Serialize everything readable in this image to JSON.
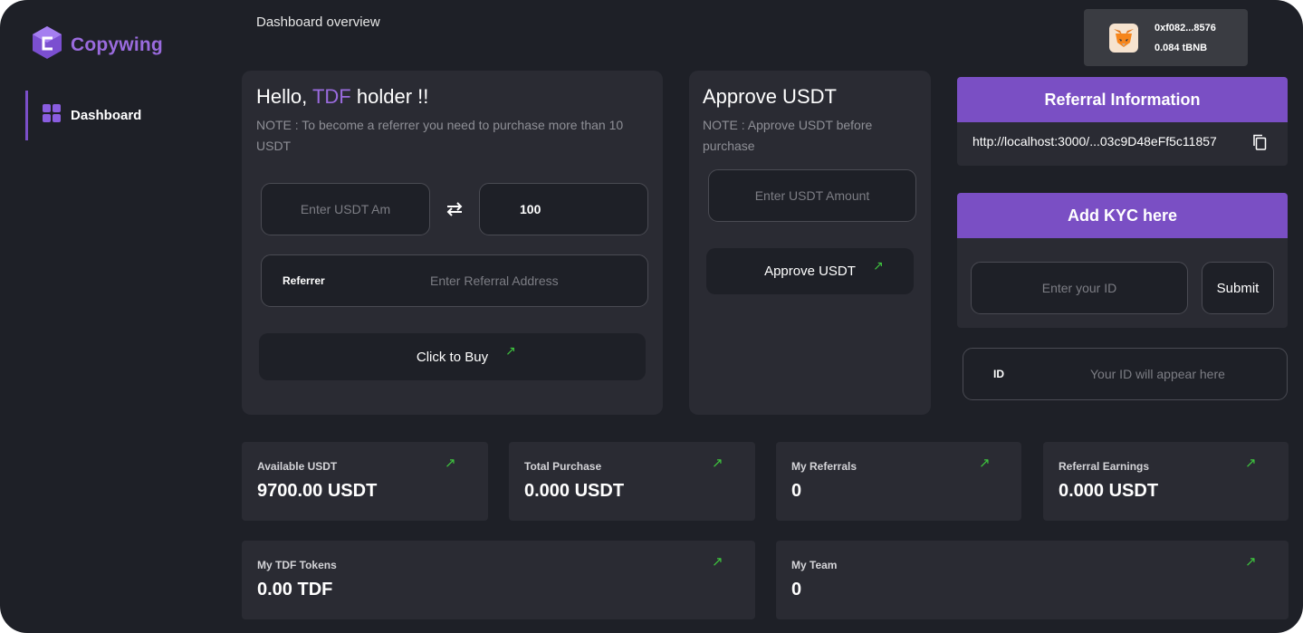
{
  "brand": {
    "name": "Copywing",
    "accent": "#9a6bde"
  },
  "sidebar": {
    "items": [
      {
        "label": "Dashboard",
        "icon": "grid-icon"
      }
    ]
  },
  "header": {
    "title": "Dashboard overview"
  },
  "wallet": {
    "address": "0xf082...8576",
    "balance": "0.084 tBNB",
    "icon": "metamask-fox-icon"
  },
  "buy_card": {
    "greeting_prefix": "Hello,",
    "greeting_token": "TDF",
    "greeting_suffix": "holder !!",
    "note": "NOTE : To become a referrer you need to purchase more than 10 USDT",
    "usdt_placeholder": "Enter USDT Am",
    "token_value": "100",
    "referrer_label": "Referrer",
    "referrer_placeholder": "Enter Referral Address",
    "buy_label": "Click to Buy"
  },
  "approve_card": {
    "title": "Approve USDT",
    "note": "NOTE : Approve USDT before purchase",
    "amount_placeholder": "Enter USDT Amount",
    "approve_label": "Approve USDT"
  },
  "referral_card": {
    "title": "Referral Information",
    "link": "http://localhost:3000/...03c9D48eFf5c11857"
  },
  "kyc_card": {
    "title": "Add KYC here",
    "id_placeholder": "Enter your ID",
    "submit_label": "Submit",
    "id_label": "ID",
    "id_display_placeholder": "Your ID will appear here"
  },
  "stats": [
    {
      "label": "Available USDT",
      "value": "9700.00 USDT"
    },
    {
      "label": "Total Purchase",
      "value": "0.000 USDT"
    },
    {
      "label": "My Referrals",
      "value": "0"
    },
    {
      "label": "Referral Earnings",
      "value": "0.000 USDT"
    },
    {
      "label": "My TDF Tokens",
      "value": "0.00 TDF"
    },
    {
      "label": "My Team",
      "value": "0"
    }
  ],
  "colors": {
    "background": "#1e2027",
    "card": "#2a2b33",
    "purple": "#7a4fc4",
    "arrow_green": "#3ec43e"
  }
}
